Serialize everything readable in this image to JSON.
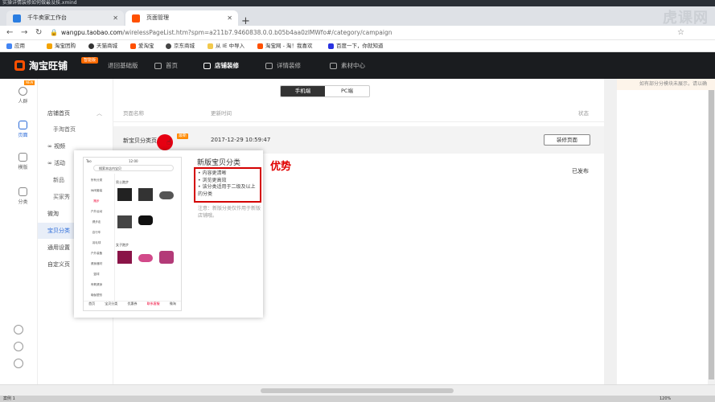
{
  "titlebar": {
    "text": "实操详情装修如何做最没技.xmind"
  },
  "tabs": [
    {
      "label": "千牛卖家工作台",
      "icon": "qianniu-icon"
    },
    {
      "label": "页面管理",
      "icon": "taobao-icon"
    }
  ],
  "address": {
    "host": "wangpu.taobao.com",
    "path": "/wirelessPageList.htm?spm=a211b7.9460838.0.0.b05b4aa0zlMWfo#/category/campaign"
  },
  "bookmarks": [
    "应用",
    "淘宝团购",
    "天猫商城",
    "爱淘宝",
    "京东商城",
    "从 IE 中导入",
    "淘宝网 - 淘！我喜欢",
    "百度一下，你就知道"
  ],
  "watermark": "虎课网",
  "header": {
    "logo": "淘宝旺铺",
    "badge": "智能版",
    "back": "退回基础版",
    "nav": [
      "首页",
      "店铺装修",
      "详情装修",
      "素材中心"
    ]
  },
  "leftbar": [
    {
      "label": "人群",
      "tag": "NEW"
    },
    {
      "label": "页面"
    },
    {
      "label": "模版"
    },
    {
      "label": "分类"
    }
  ],
  "menu": {
    "items": [
      "店铺首页",
      "手淘首页",
      "视频",
      "活动",
      "新品",
      "买家秀",
      "微淘",
      "宝贝分类",
      "通用设置",
      "自定义页"
    ]
  },
  "segment": {
    "mobile": "手机端",
    "pc": "PC端"
  },
  "table": {
    "col_name": "页面名称",
    "col_time": "更新时间",
    "col_status": "状态",
    "row": {
      "name": "新宝贝分类页",
      "tag": "最新",
      "time": "2017-12-29 10:59:47",
      "action": "装修页面"
    },
    "status2": "已发布"
  },
  "popup": {
    "title": "新版宝贝分类",
    "bullets": [
      "内容更清晰",
      "浏览更高效",
      "该分类适用于二级及以上的分类"
    ],
    "note": "注意：新版分类仅作用于新版店铺哦。",
    "phone": {
      "status": "Tao",
      "time": "12:00",
      "search": "搜索本店内宝贝",
      "categories": [
        "所有分类",
        "休闲套装",
        "跑步",
        "户外运动",
        "健步走",
        "自行车",
        "羽毛球",
        "户外装备",
        "健身器材",
        "篮球",
        "有氧健身",
        "瑜伽塑形"
      ],
      "section1": "男士跑步",
      "section2": "女子跑步",
      "tabs": [
        "首页",
        "宝贝分类",
        "优惠券",
        "联系客服",
        "微淘"
      ]
    }
  },
  "annotation": "优势",
  "hint": "如有部分分模块未展示，请以确",
  "statusbar": {
    "left": "案例 1",
    "zoom": "120%"
  },
  "colors": {
    "header_bg": "#1a1c1f",
    "accent": "#ff5000",
    "highlight": "#d40000",
    "active": "#2b6bd9"
  }
}
